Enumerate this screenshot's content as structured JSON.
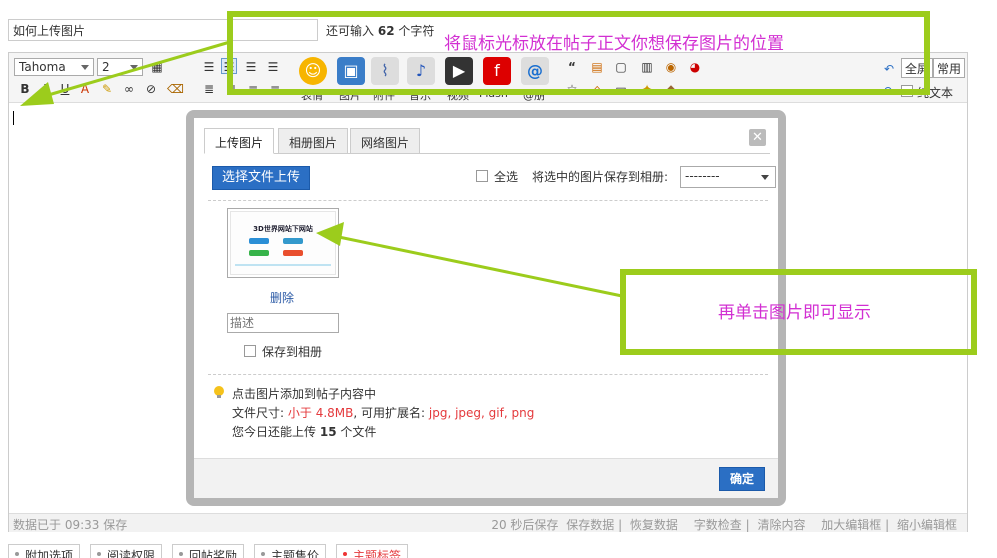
{
  "title_field": {
    "value": "如何上传图片"
  },
  "char_count": {
    "prefix": "还可输入",
    "count": "62",
    "suffix": "个字符"
  },
  "toolbar": {
    "font_family": "Tahoma",
    "font_size": "2",
    "btn_fullscreen": "全屏",
    "btn_common": "常用",
    "btn_plaintext": "纯文本",
    "big_labels": [
      "表情",
      "图片",
      "附件",
      "音乐",
      "视频",
      "Flash",
      "@朋"
    ]
  },
  "status_bar": {
    "saved": "数据已于 09:33 保存",
    "autosave": "20 秒后保存",
    "save": "保存数据",
    "restore": "恢复数据",
    "wordcheck": "字数检查",
    "clear": "清除内容",
    "enlarge": "加大编辑框",
    "shrink": "缩小编辑框"
  },
  "bottom_tabs": [
    "附加选项",
    "阅读权限",
    "回帖奖励",
    "主题售价",
    "主题标签"
  ],
  "dialog": {
    "tabs": [
      "上传图片",
      "相册图片",
      "网络图片"
    ],
    "upload_button": "选择文件上传",
    "select_all": "全选",
    "save_to_album_label": "将选中的图片保存到相册:",
    "album_option": "--------",
    "thumb_caption": "3D世界网站下网站",
    "delete": "删除",
    "desc_placeholder": "描述",
    "save_to_album": "保存到相册",
    "tip": "点击图片添加到帖子内容中",
    "size_label": "文件尺寸:",
    "size_value": "小于 4.8MB",
    "ext_label": ", 可用扩展名:",
    "ext_value": "jpg, jpeg, gif, png",
    "today_prefix": "您今日还能上传",
    "today_count": "15",
    "today_suffix": "个文件",
    "ok": "确定"
  },
  "annotations": {
    "top": "将鼠标光标放在帖子正文你想保存图片的位置",
    "right": "再单击图片即可显示"
  },
  "colors": {
    "annotation_green": "#9ccc1c",
    "annotation_text": "#d22fd2",
    "primary_blue": "#2b6fc4"
  }
}
